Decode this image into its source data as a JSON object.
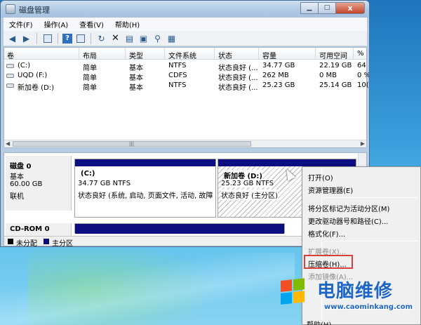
{
  "window": {
    "title": "磁盘管理",
    "minimize": "▁",
    "maximize": "□",
    "close": "x"
  },
  "menu": [
    "文件(F)",
    "操作(A)",
    "查看(V)",
    "帮助(H)"
  ],
  "volumes": {
    "columns": [
      "卷",
      "布局",
      "类型",
      "文件系统",
      "状态",
      "容量",
      "可用空间",
      "%"
    ],
    "rows": [
      [
        "(C:)",
        "简单",
        "基本",
        "NTFS",
        "状态良好 (...",
        "34.77 GB",
        "22.19 GB",
        "64"
      ],
      [
        "UQD (F:)",
        "简单",
        "基本",
        "CDFS",
        "状态良好 (...",
        "262 MB",
        "0 MB",
        "0 %"
      ],
      [
        "新加卷 (D:)",
        "简单",
        "基本",
        "NTFS",
        "状态良好 (...",
        "25.23 GB",
        "25.14 GB",
        "10("
      ]
    ],
    "scroll_grip": "|||"
  },
  "disk0": {
    "name": "磁盘 0",
    "type": "基本",
    "size": "60.00 GB",
    "status": "联机",
    "partitions": [
      {
        "name": "(C:)",
        "detail": "34.77 GB NTFS",
        "status": "状态良好 (系统, 启动, 页面文件, 活动, 故障"
      },
      {
        "name": "新加卷  (D:)",
        "detail": "25.23 GB NTFS",
        "status": "状态良好 (主分区)"
      }
    ]
  },
  "cdrom": {
    "name": "CD-ROM 0"
  },
  "legend": [
    {
      "label": "未分配",
      "color": "#000000"
    },
    {
      "label": "主分区",
      "color": "#0d0d7f"
    }
  ],
  "context_menu": {
    "items": [
      {
        "label": "打开(O)",
        "enabled": true
      },
      {
        "label": "资源管理器(E)",
        "enabled": true
      },
      {
        "label": "将分区标记为活动分区(M)",
        "enabled": true
      },
      {
        "label": "更改驱动器号和路径(C)...",
        "enabled": true
      },
      {
        "label": "格式化(F)...",
        "enabled": true
      },
      {
        "label": "扩展卷(X)...",
        "enabled": false
      },
      {
        "label": "压缩卷(H)...",
        "enabled": true,
        "highlighted": true
      },
      {
        "label": "添加镜像(A)...",
        "enabled": false
      }
    ],
    "cut_off_item": "帮助(H)"
  },
  "watermark": {
    "brand": "电脑维修",
    "url": "www.caominkang.com"
  },
  "colors": {
    "primary_partition": "#0d0d7f",
    "highlight_box": "#d9403a",
    "watermark": "#1d66c7"
  }
}
